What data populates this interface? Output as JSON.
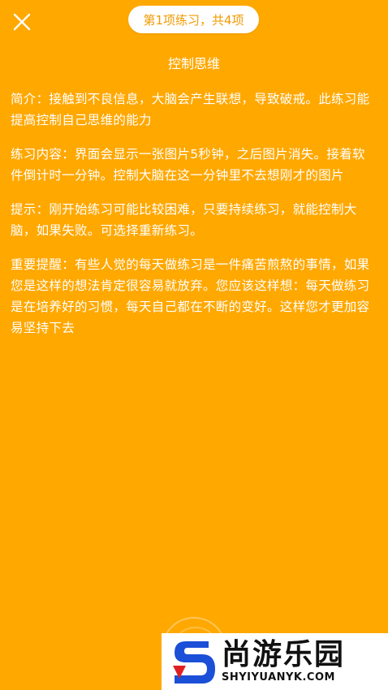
{
  "header": {
    "progress_label": "第1项练习，共4项"
  },
  "main": {
    "title": "控制思维",
    "paragraphs": [
      "简介：接触到不良信息，大脑会产生联想，导致破戒。此练习能提高控制自己思维的能力",
      "练习内容：界面会显示一张图片5秒钟，之后图片消失。接着软件倒计时一分钟。控制大脑在这一分钟里不去想刚才的图片",
      "提示：刚开始练习可能比较困难，只要持续练习，就能控制大脑，如果失败。可选择重新练习。",
      "重要提醒：有些人觉的每天做练习是一件痛苦煎熬的事情，如果您是这样的想法肯定很容易就放弃。您应该这样想：每天做练习是在培养好的习惯，每天自己都在不断的变好。这样您才更加容易坚持下去"
    ]
  },
  "watermark": {
    "name_cn": "尚游乐园",
    "domain": "SHYIYUANYK.COM"
  },
  "colors": {
    "background": "#FFA800",
    "pill_text": "#F29A00",
    "logo_blue": "#1B4FD8",
    "logo_red": "#E02020"
  }
}
